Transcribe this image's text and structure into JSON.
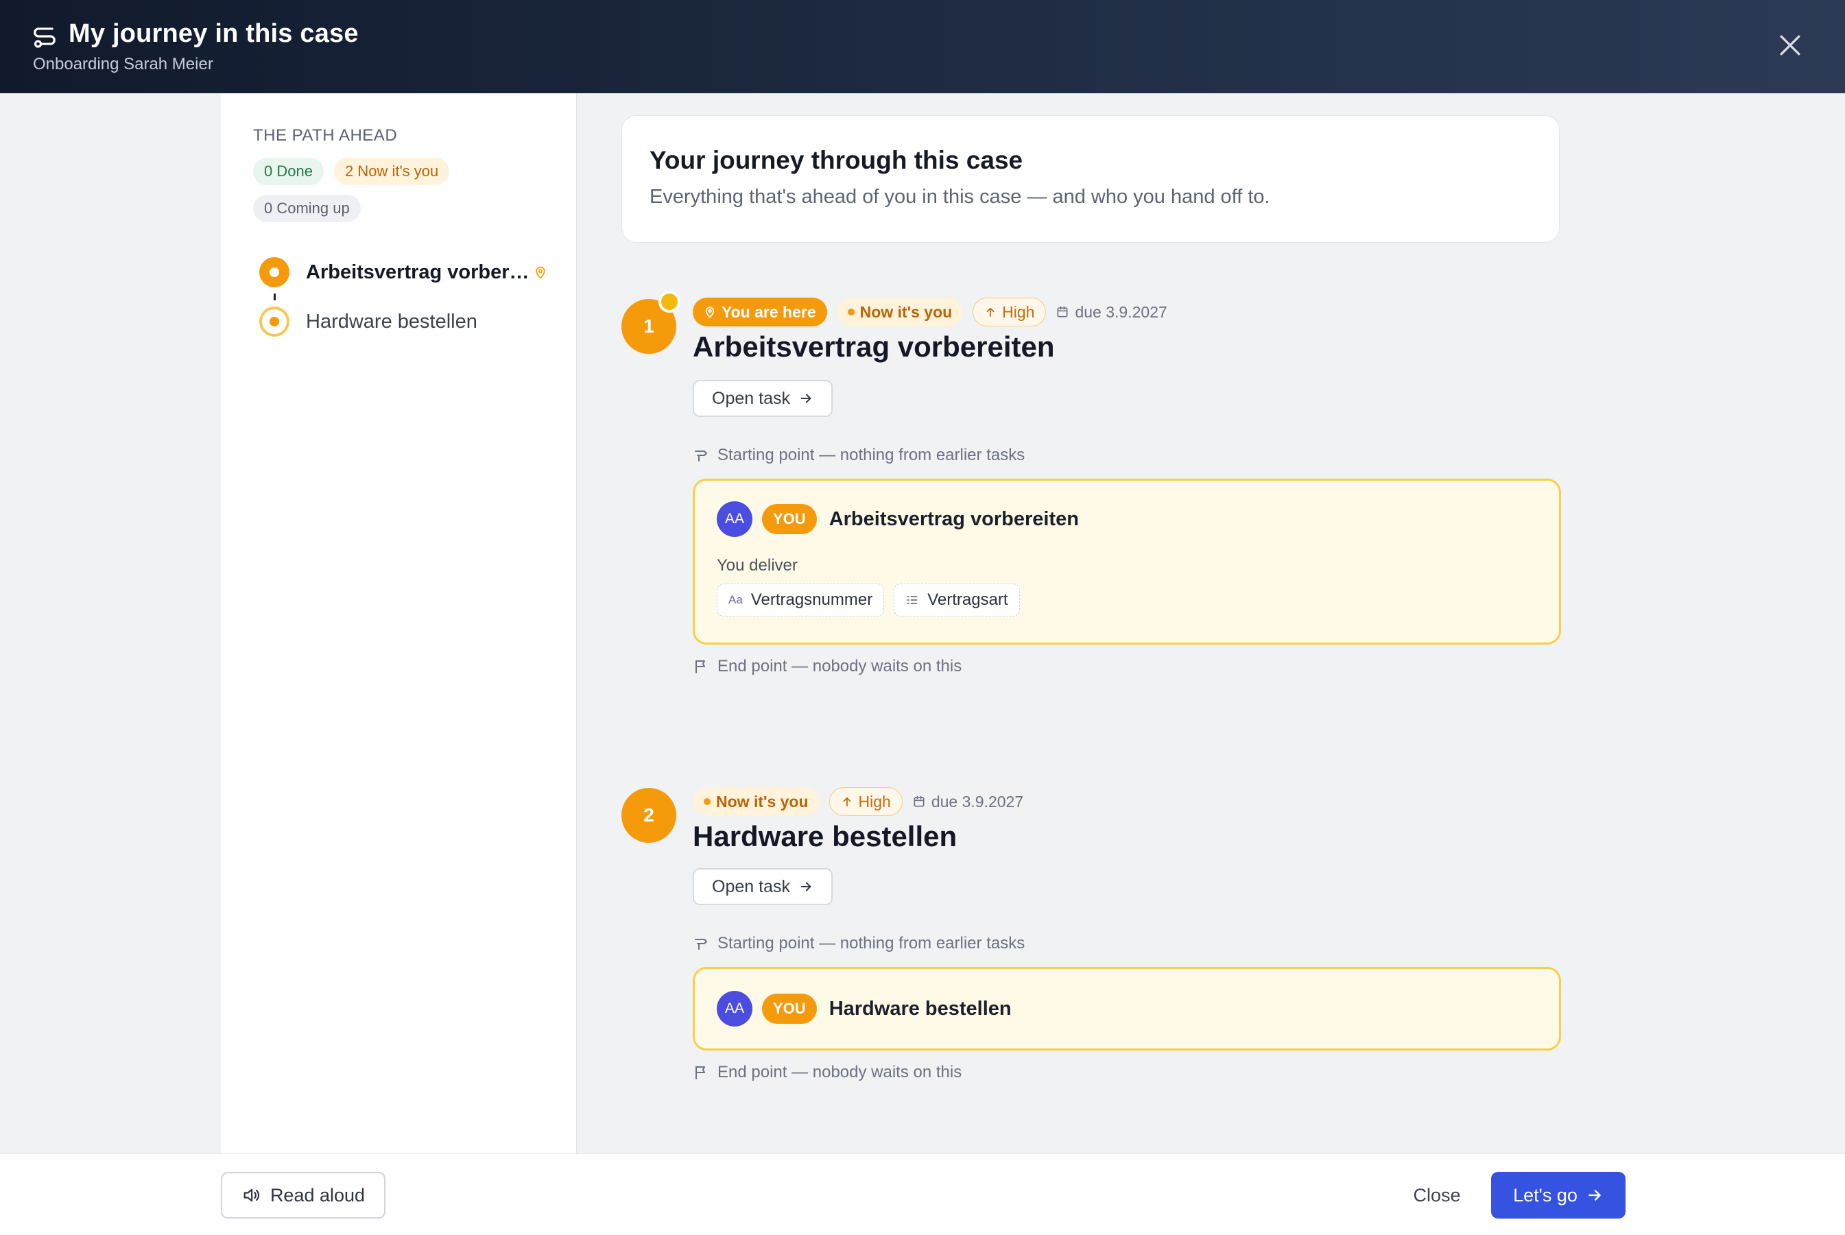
{
  "header": {
    "title": "My journey in this case",
    "subtitle": "Onboarding Sarah Meier"
  },
  "sidebar": {
    "heading": "THE PATH AHEAD",
    "chips": {
      "done": "0 Done",
      "now": "2 Now it's you",
      "coming": "0 Coming up"
    },
    "steps": [
      {
        "label": "Arbeitsvertrag vorber…",
        "state": "current"
      },
      {
        "label": "Hardware bestellen",
        "state": "upcoming"
      }
    ]
  },
  "intro": {
    "title": "Your journey through this case",
    "text": "Everything that's ahead of you in this case — and who you hand off to."
  },
  "tasks": [
    {
      "number": "1",
      "here_badge": "You are here",
      "status_badge": "Now it's you",
      "priority_badge": "High",
      "due": "due 3.9.2027",
      "title": "Arbeitsvertrag vorbereiten",
      "open_label": "Open task",
      "start_text": "Starting point — nothing from earlier tasks",
      "card": {
        "avatar": "AA",
        "you": "YOU",
        "title": "Arbeitsvertrag vorbereiten",
        "deliver_label": "You deliver",
        "fields": [
          {
            "icon": "text-field-icon",
            "label": "Vertragsnummer"
          },
          {
            "icon": "list-field-icon",
            "label": "Vertragsart"
          }
        ]
      },
      "end_text": "End point — nobody waits on this"
    },
    {
      "number": "2",
      "status_badge": "Now it's you",
      "priority_badge": "High",
      "due": "due 3.9.2027",
      "title": "Hardware bestellen",
      "open_label": "Open task",
      "start_text": "Starting point — nothing from earlier tasks",
      "card": {
        "avatar": "AA",
        "you": "YOU",
        "title": "Hardware bestellen"
      },
      "end_text": "End point — nobody waits on this"
    }
  ],
  "footer": {
    "read_aloud": "Read aloud",
    "close": "Close",
    "lets_go": "Let's go"
  },
  "colors": {
    "accent_orange": "#f59a0b",
    "primary_blue": "#3552e0",
    "header_dark": "#111a2c",
    "card_yellow": "#fffae8"
  }
}
